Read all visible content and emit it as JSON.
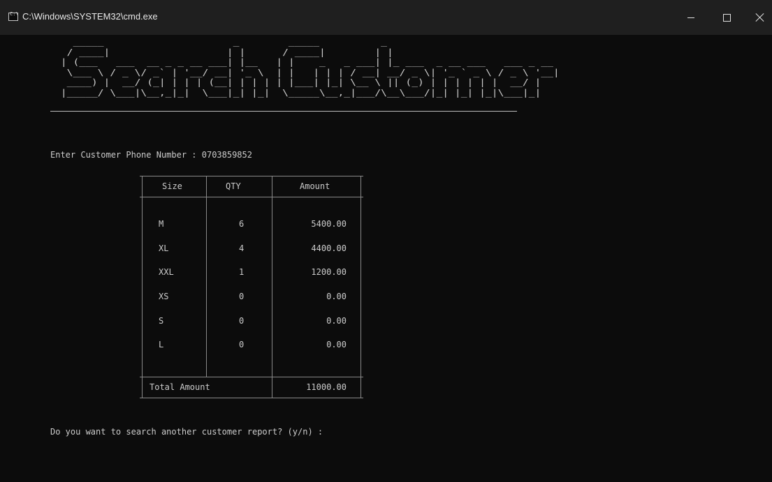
{
  "window": {
    "title": "C:\\Windows\\SYSTEM32\\cmd.exe",
    "icon_text": "C:\\"
  },
  "console": {
    "banner": "   _____                     _        _____          _                           \n  / ____|                   | |      / ____|        | |                          \n | (___   ___  __ _ _ __ ___| |__   | |    _   _ ___| |_ ___  _ __ ___   ___ _ __ \n  \\___ \\ / _ \\/ _` | '__/ __| '_ \\  | |   | | | / __| __/ _ \\| '_ ` _ \\ / _ \\ '__|\n  ____) |  __/ (_| | | | (__| | | | | |___| |_| \\__ \\ || (_) | | | | | |  __/ |   \n |_____/ \\___|\\__,_|_|  \\___|_| |_|  \\_____\\__,_|___/\\__\\___/|_| |_| |_|\\___|_|   ",
    "phone_prompt": "Enter Customer Phone Number : 0703859852",
    "again_prompt": "Do you want to search another customer report? (y/n) :"
  },
  "table": {
    "headers": {
      "size": "Size",
      "qty": "QTY",
      "amount": "Amount"
    },
    "rows": [
      {
        "size": "M",
        "qty": "6",
        "amount": "5400.00"
      },
      {
        "size": "XL",
        "qty": "4",
        "amount": "4400.00"
      },
      {
        "size": "XXL",
        "qty": "1",
        "amount": "1200.00"
      },
      {
        "size": "XS",
        "qty": "0",
        "amount": "0.00"
      },
      {
        "size": "S",
        "qty": "0",
        "amount": "0.00"
      },
      {
        "size": "L",
        "qty": "0",
        "amount": "0.00"
      }
    ],
    "total_label": "Total Amount",
    "total_value": "11000.00"
  }
}
